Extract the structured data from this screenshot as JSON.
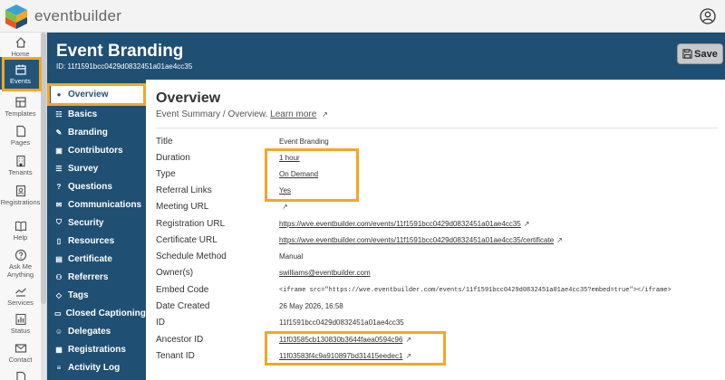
{
  "app": {
    "brand": "eventbuilder"
  },
  "leftnav": {
    "items": [
      {
        "label": "Home"
      },
      {
        "label": "Events"
      },
      {
        "label": "Templates"
      },
      {
        "label": "Pages"
      },
      {
        "label": "Tenants"
      },
      {
        "label": "Registrations"
      },
      {
        "label": "Help"
      },
      {
        "label": "Ask Me Anything"
      },
      {
        "label": "Services"
      },
      {
        "label": "Status"
      },
      {
        "label": "Contact"
      }
    ]
  },
  "header": {
    "title": "Event Branding",
    "id_text": "ID: 11f1591bcc0429d0832451a01ae4cc35",
    "save_label": "Save"
  },
  "subnav": {
    "items": [
      {
        "label": "Overview",
        "icon": "info-icon"
      },
      {
        "label": "Basics",
        "icon": "sliders-icon"
      },
      {
        "label": "Branding",
        "icon": "brush-icon"
      },
      {
        "label": "Contributors",
        "icon": "id-card-icon"
      },
      {
        "label": "Survey",
        "icon": "list-icon"
      },
      {
        "label": "Questions",
        "icon": "question-icon"
      },
      {
        "label": "Communications",
        "icon": "envelope-icon"
      },
      {
        "label": "Security",
        "icon": "shield-icon"
      },
      {
        "label": "Resources",
        "icon": "file-icon"
      },
      {
        "label": "Certificate",
        "icon": "certificate-icon"
      },
      {
        "label": "Referrers",
        "icon": "users-icon"
      },
      {
        "label": "Tags",
        "icon": "tag-icon"
      },
      {
        "label": "Closed Captioning",
        "icon": "cc-icon"
      },
      {
        "label": "Delegates",
        "icon": "user-plus-icon"
      },
      {
        "label": "Registrations",
        "icon": "clipboard-icon"
      },
      {
        "label": "Activity Log",
        "icon": "list-lines-icon"
      }
    ]
  },
  "overview": {
    "title": "Overview",
    "subtitle": "Event Summary / Overview.",
    "learn_more": "Learn more",
    "ext_glyph": "↗",
    "rows": [
      {
        "label": "Title",
        "value": "Event Branding"
      },
      {
        "label": "Duration",
        "value": "1 hour"
      },
      {
        "label": "Type",
        "value": "On Demand"
      },
      {
        "label": "Referral Links",
        "value": "Yes"
      },
      {
        "label": "Meeting URL",
        "value": ""
      },
      {
        "label": "Registration URL",
        "value": "https://wve.eventbuilder.com/events/11f1591bcc0429d0832451a01ae4cc35"
      },
      {
        "label": "Certificate URL",
        "value": "https://wve.eventbuilder.com/events/11f1591bcc0429d0832451a01ae4cc35/certificate"
      },
      {
        "label": "Schedule Method",
        "value": "Manual"
      },
      {
        "label": "Owner(s)",
        "value": "swilliams@eventbuilder.com"
      },
      {
        "label": "Embed Code",
        "value": "<iframe src=\"https://wve.eventbuilder.com/events/11f1591bcc0429d0832451a01ae4cc35?embed=true\"></iframe>"
      },
      {
        "label": "Date Created",
        "value": "26 May 2026, 16:58"
      },
      {
        "label": "ID",
        "value": "11f1591bcc0429d0832451a01ae4cc35"
      },
      {
        "label": "Ancestor ID",
        "value": "11f03585cb130830b3644faea0594c96"
      },
      {
        "label": "Tenant ID",
        "value": "11f03583f4c9a910897bd31415eedec1"
      }
    ]
  },
  "colors": {
    "primary": "#1f4f73",
    "highlight": "#f5a623"
  }
}
